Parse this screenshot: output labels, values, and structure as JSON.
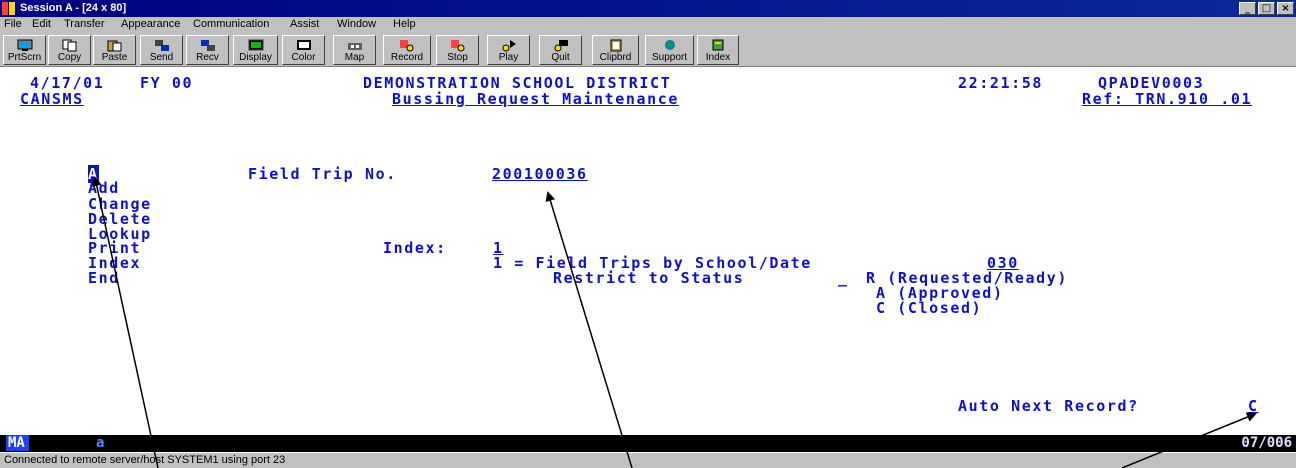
{
  "window": {
    "title": "Session A - [24 x 80]",
    "controls": [
      "_",
      "□",
      "×"
    ]
  },
  "menu": [
    "File",
    "Edit",
    "Transfer",
    "Appearance",
    "Communication",
    "Assist",
    "Window",
    "Help"
  ],
  "toolbar": [
    {
      "label": "PrtScrn",
      "icon": "print-screen-icon"
    },
    {
      "label": "Copy",
      "icon": "copy-icon"
    },
    {
      "label": "Paste",
      "icon": "paste-icon"
    },
    {
      "label": "Send",
      "icon": "send-icon"
    },
    {
      "label": "Recv",
      "icon": "receive-icon"
    },
    {
      "label": "Display",
      "icon": "display-icon"
    },
    {
      "label": "Color",
      "icon": "color-icon"
    },
    {
      "label": "Map",
      "icon": "map-icon"
    },
    {
      "label": "Record",
      "icon": "record-icon"
    },
    {
      "label": "Stop",
      "icon": "stop-icon"
    },
    {
      "label": "Play",
      "icon": "play-icon"
    },
    {
      "label": "Quit",
      "icon": "quit-icon"
    },
    {
      "label": "Clipbrd",
      "icon": "clipboard-icon"
    },
    {
      "label": "Support",
      "icon": "support-icon"
    },
    {
      "label": "Index",
      "icon": "index-icon"
    }
  ],
  "terminal": {
    "date": "4/17/01",
    "fiscal_year": "FY 00",
    "district": "DEMONSTRATION SCHOOL DISTRICT",
    "time": "22:21:58",
    "screen_id": "QPADEV0003",
    "user": "CANSMS",
    "screen_title": "Bussing Request Maintenance",
    "ref": "Ref: TRN.910 .01",
    "action_value": "A",
    "actions": [
      "Add",
      "Change",
      "Delete",
      "Lookup",
      "Print",
      "Index",
      "End"
    ],
    "field_trip_label": "Field Trip No.",
    "field_trip_value": "200100036",
    "index_label": "Index:",
    "index_value": "1",
    "index_option": "1 = Field Trips by School/Date",
    "index_option_value": "030",
    "restrict_label": "Restrict to Status",
    "restrict_value": "_",
    "statuses": [
      "R (Requested/Ready)",
      "A (Approved)",
      "C (Closed)"
    ],
    "auto_next_label": "Auto Next Record?",
    "auto_next_value": "C"
  },
  "status_line": {
    "mode": "MA",
    "marker": "a",
    "cursor_position": "07/006"
  },
  "statusbar": {
    "text": "Connected to remote server/host SYSTEM1 using port 23"
  },
  "colors": {
    "terminal_text": "#1010c8",
    "titlebar": "#000080",
    "chrome": "#c0c0c0"
  }
}
